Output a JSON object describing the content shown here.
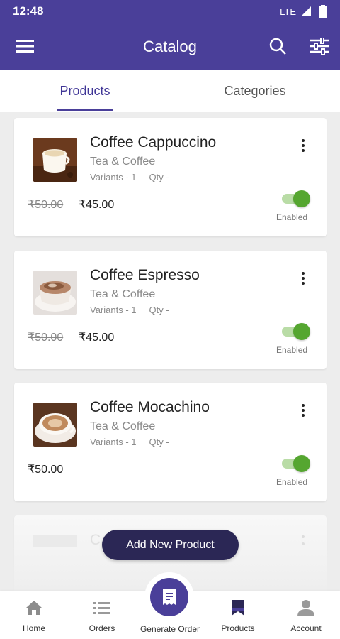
{
  "status_bar": {
    "time": "12:48",
    "network": "LTE"
  },
  "toolbar": {
    "title": "Catalog"
  },
  "tabs": [
    {
      "label": "Products",
      "selected": true
    },
    {
      "label": "Categories",
      "selected": false
    }
  ],
  "products": [
    {
      "name": "Coffee Cappuccino",
      "category": "Tea & Coffee",
      "variants": "Variants - 1",
      "qty": "Qty -",
      "mrp": "₹50.00",
      "price": "₹45.00",
      "status": "Enabled",
      "enabled": true
    },
    {
      "name": "Coffee Espresso",
      "category": "Tea & Coffee",
      "variants": "Variants - 1",
      "qty": "Qty -",
      "mrp": "₹50.00",
      "price": "₹45.00",
      "status": "Enabled",
      "enabled": true
    },
    {
      "name": "Coffee Mocachino",
      "category": "Tea & Coffee",
      "variants": "Variants - 1",
      "qty": "Qty -",
      "price": "₹50.00",
      "status": "Enabled",
      "enabled": true
    },
    {
      "name": "C"
    }
  ],
  "add_button": {
    "label": "Add New Product"
  },
  "bottom_nav": [
    {
      "label": "Home",
      "icon": "home-icon"
    },
    {
      "label": "Orders",
      "icon": "list-icon"
    },
    {
      "label": "Generate Order",
      "icon": "receipt-icon"
    },
    {
      "label": "Products",
      "icon": "bookmark-icon",
      "active": true
    },
    {
      "label": "Account",
      "icon": "person-icon"
    }
  ],
  "colors": {
    "primary": "#4a3f99",
    "toggle_on": "#55a630",
    "fab": "#2b2755"
  }
}
